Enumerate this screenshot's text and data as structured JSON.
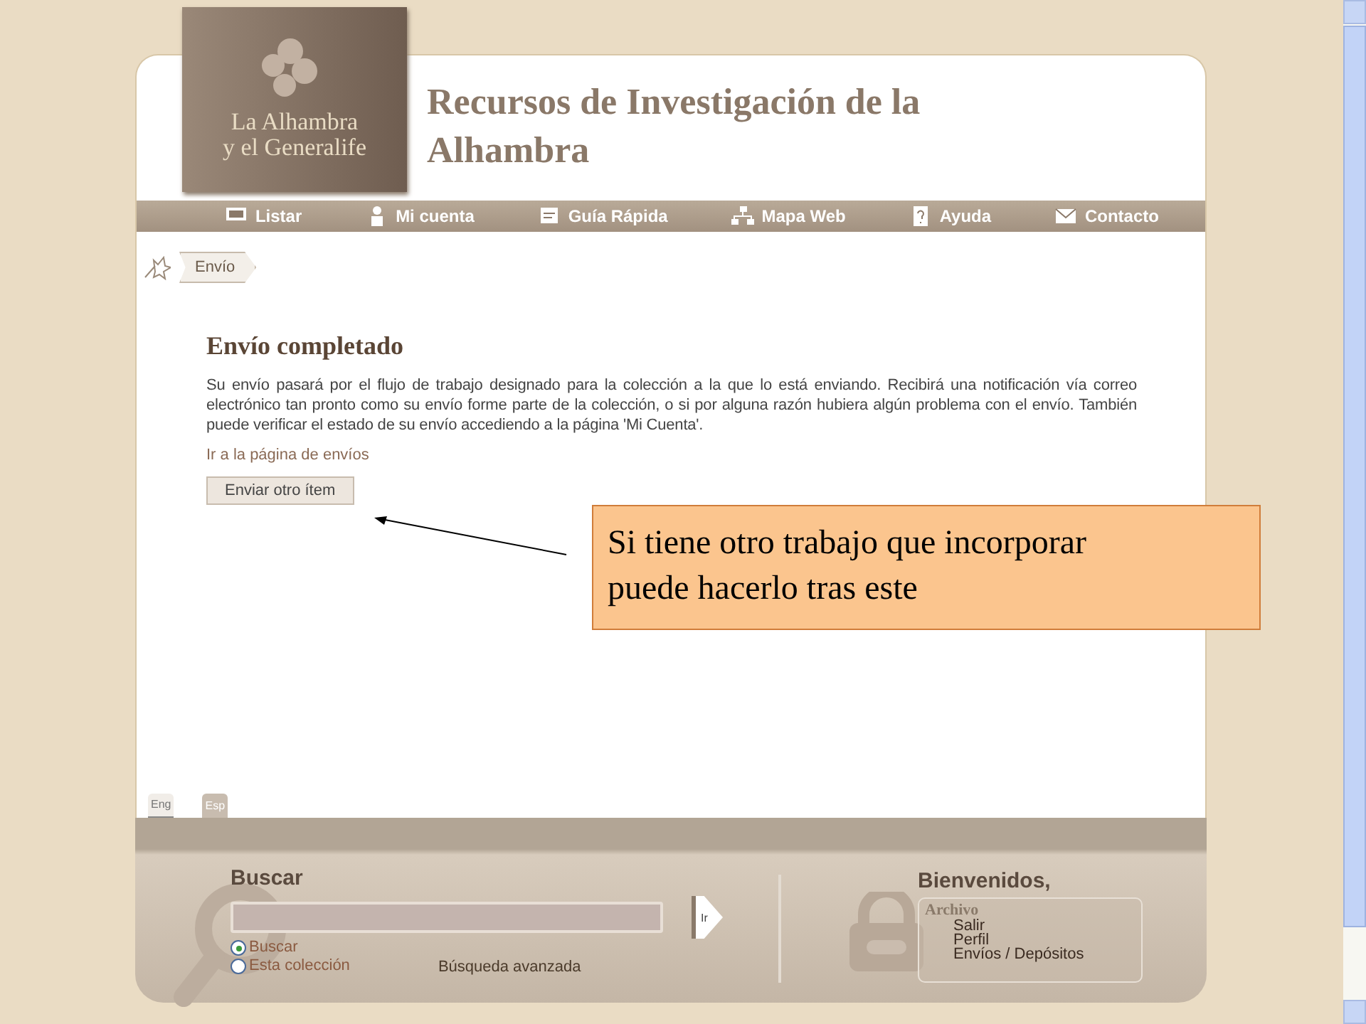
{
  "logo": {
    "lines": [
      "La Alhambra",
      "y el Generalife"
    ]
  },
  "site_title": "Recursos de Investigación de la Alhambra",
  "nav": [
    {
      "label": "Listar"
    },
    {
      "label": "Mi cuenta"
    },
    {
      "label": "Guía Rápida"
    },
    {
      "label": "Mapa Web"
    },
    {
      "label": "Ayuda"
    },
    {
      "label": "Contacto"
    }
  ],
  "breadcrumb": [
    "Envío"
  ],
  "content": {
    "heading": "Envío completado",
    "paragraph": "Su envío pasará por el flujo de trabajo designado para la colección a la que lo está enviando. Recibirá una notificación vía correo electrónico tan pronto como su envío forme parte de la colección, o si por alguna razón hubiera algún problema con el envío. También puede verificar el estado de su envío accediendo a la página 'Mi Cuenta'.",
    "link": "Ir a la página de envíos",
    "button": "Enviar otro ítem"
  },
  "callout": {
    "text": "Si tiene otro trabajo que incorporar puede hacerlo tras este"
  },
  "languages": [
    {
      "label": "Eng",
      "selected": false
    },
    {
      "label": "Esp",
      "selected": true
    }
  ],
  "search": {
    "label": "Buscar",
    "go_button": "Ir",
    "scopes": [
      {
        "label": "Buscar",
        "selected": true
      },
      {
        "label": "Esta colección",
        "selected": false
      }
    ],
    "advanced_link": "Búsqueda avanzada"
  },
  "account": {
    "welcome": "Bienvenidos,",
    "box_title": "Archivo",
    "links": [
      "Salir",
      "Perfil",
      "Envíos / Depósitos"
    ]
  }
}
